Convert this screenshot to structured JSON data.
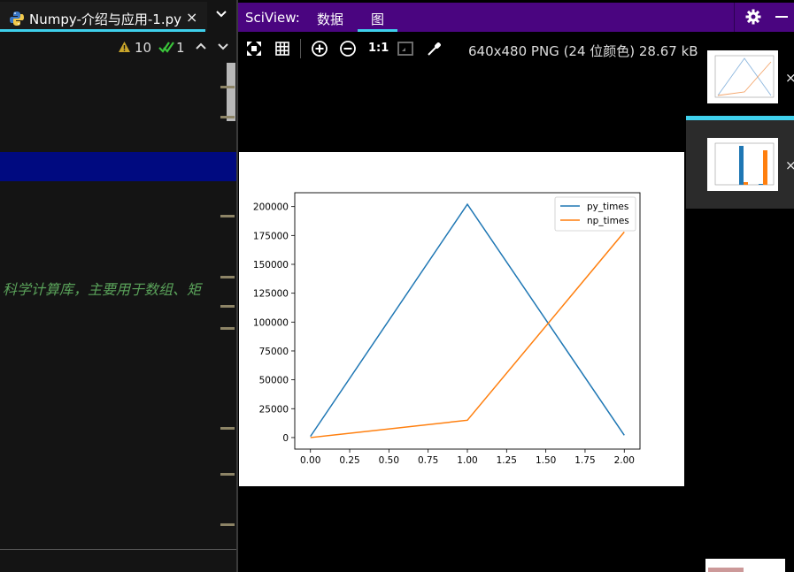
{
  "editor": {
    "tab_title": "Numpy-介绍与应用-1.py",
    "tab_close": "×",
    "warnings_count": "10",
    "ok_count": "1",
    "comment_text": "科学计算库，主要用于数组、矩"
  },
  "sciview": {
    "title": "SciView:",
    "tabs": [
      {
        "label": "数据",
        "active": false
      },
      {
        "label": "图",
        "active": true
      }
    ],
    "toolbar": {
      "zoom_actual_label": "1:1"
    },
    "image_info": "640x480 PNG (24 位颜色) 28.67 kB",
    "thumb_close": "×"
  },
  "colors": {
    "accent": "#3fd0ec",
    "header": "#4a0580",
    "selected_line": "#000a80",
    "series_blue": "#1f77b4",
    "series_orange": "#ff7f0e"
  },
  "chart_data": {
    "type": "line",
    "x": [
      0,
      1,
      2
    ],
    "series": [
      {
        "name": "py_times",
        "values": [
          1000,
          202000,
          2000
        ]
      },
      {
        "name": "np_times",
        "values": [
          0,
          15000,
          178000
        ]
      }
    ],
    "xticks": [
      "0.00",
      "0.25",
      "0.50",
      "0.75",
      "1.00",
      "1.25",
      "1.50",
      "1.75",
      "2.00"
    ],
    "yticks": [
      "0",
      "25000",
      "50000",
      "75000",
      "100000",
      "125000",
      "150000",
      "175000",
      "200000"
    ],
    "xlim": [
      -0.1,
      2.1
    ],
    "ylim": [
      -10000,
      212000
    ],
    "legend": "top-right",
    "grid": false
  }
}
